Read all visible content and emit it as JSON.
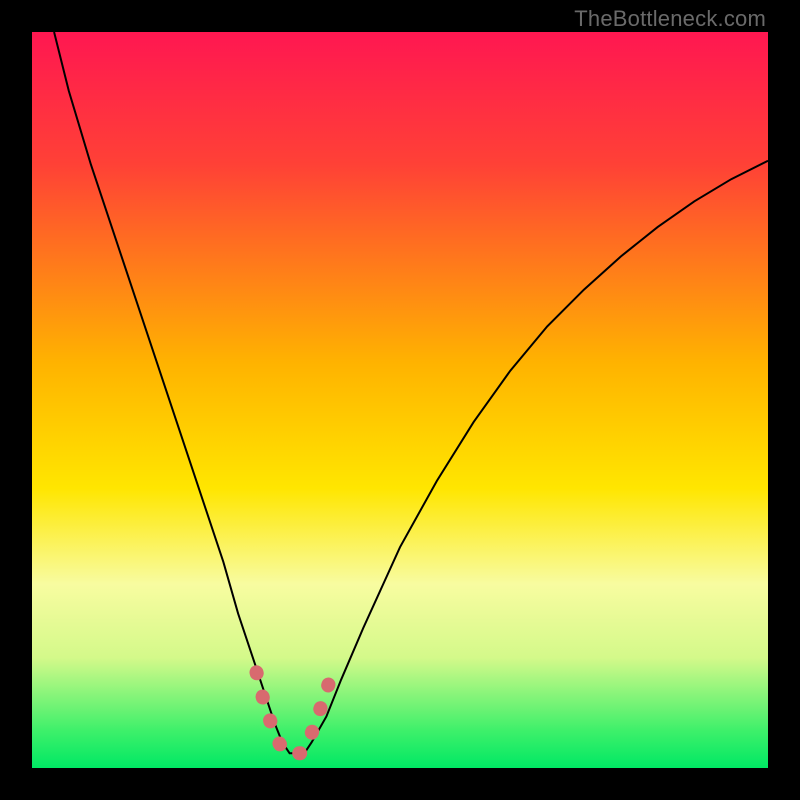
{
  "watermark": "TheBottleneck.com",
  "chart_data": {
    "type": "line",
    "title": "",
    "xlabel": "",
    "ylabel": "",
    "xlim": [
      0,
      100
    ],
    "ylim": [
      0,
      100
    ],
    "background_gradient": {
      "stops": [
        {
          "offset": 0,
          "color": "#ff1751"
        },
        {
          "offset": 18,
          "color": "#ff4136"
        },
        {
          "offset": 45,
          "color": "#ffb300"
        },
        {
          "offset": 62,
          "color": "#ffe600"
        },
        {
          "offset": 75,
          "color": "#f8fca0"
        },
        {
          "offset": 85,
          "color": "#d4f98a"
        },
        {
          "offset": 95,
          "color": "#3df06a"
        },
        {
          "offset": 100,
          "color": "#00e864"
        }
      ]
    },
    "series": [
      {
        "name": "bottleneck-curve",
        "color": "#000000",
        "stroke_width": 2,
        "x": [
          3,
          5,
          8,
          11,
          14,
          17,
          20,
          23,
          26,
          28,
          30,
          32,
          33,
          34,
          35,
          36,
          37,
          38,
          40,
          42,
          45,
          50,
          55,
          60,
          65,
          70,
          75,
          80,
          85,
          90,
          95,
          100
        ],
        "values": [
          100,
          92,
          82,
          73,
          64,
          55,
          46,
          37,
          28,
          21,
          15,
          9,
          6,
          3.5,
          2,
          2,
          2,
          3.5,
          7,
          12,
          19,
          30,
          39,
          47,
          54,
          60,
          65,
          69.5,
          73.5,
          77,
          80,
          82.5
        ]
      },
      {
        "name": "highlight-trough",
        "color": "#d86a6f",
        "stroke_width": 14,
        "linecap": "round",
        "dash": "1 24",
        "x": [
          30.5,
          31.5,
          32.5,
          33.5,
          34.5,
          35.5,
          36.5,
          37.5,
          38.5,
          39.5,
          40.5
        ],
        "values": [
          13,
          9,
          6,
          3.5,
          2,
          2,
          2,
          3.5,
          6,
          9,
          12
        ]
      }
    ]
  }
}
